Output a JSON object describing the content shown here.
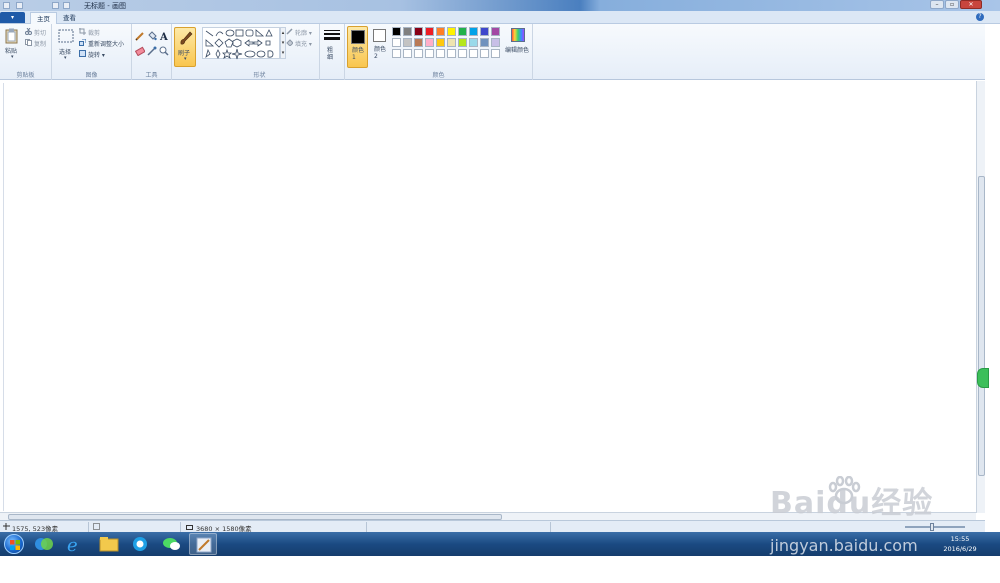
{
  "window": {
    "title": "无标题 - 画图",
    "minimize": "–",
    "restore": "▫",
    "close": "✕"
  },
  "ribbon_tabs": {
    "app_menu": "▾",
    "tabs": [
      {
        "label": "主页"
      },
      {
        "label": "查看"
      }
    ],
    "help": "?"
  },
  "clipboard": {
    "paste": "粘贴",
    "cut": "剪切",
    "copy": "复制",
    "group_label": "剪贴板"
  },
  "image": {
    "select": "选择",
    "crop": "裁剪",
    "resize": "重新调整大小",
    "rotate": "旋转 ▾",
    "group_label": "图像"
  },
  "tools": {
    "group_label": "工具"
  },
  "brushes": {
    "label": "刷子"
  },
  "shapes": {
    "outline": "轮廓 ▾",
    "fill": "填充 ▾",
    "group_label": "形状"
  },
  "size": {
    "label": "粗细"
  },
  "colors": {
    "color1_label": "颜色 1",
    "color2_label": "颜色 2",
    "edit_colors": "编辑颜色",
    "group_label": "颜色",
    "color1": "#000000",
    "color2": "#ffffff",
    "palette_row1": [
      "#000000",
      "#7f7f7f",
      "#880015",
      "#ed1c24",
      "#ff7f27",
      "#fff200",
      "#22b14c",
      "#00a2e8",
      "#3f48cc",
      "#a349a4"
    ],
    "palette_row2": [
      "#ffffff",
      "#c3c3c3",
      "#b97a57",
      "#ffaec9",
      "#ffc90e",
      "#efe4b0",
      "#b5e61d",
      "#99d9ea",
      "#7092be",
      "#c8bfe7"
    ]
  },
  "statusbar": {
    "cursor_pos": "1575, 523像素",
    "image_size": "3680 × 1580像素"
  },
  "taskbar": {
    "clock_time": "15:55",
    "clock_date": "2016/6/29"
  },
  "watermark": {
    "brand": "Baidu经验",
    "url": "jingyan.baidu.com"
  }
}
